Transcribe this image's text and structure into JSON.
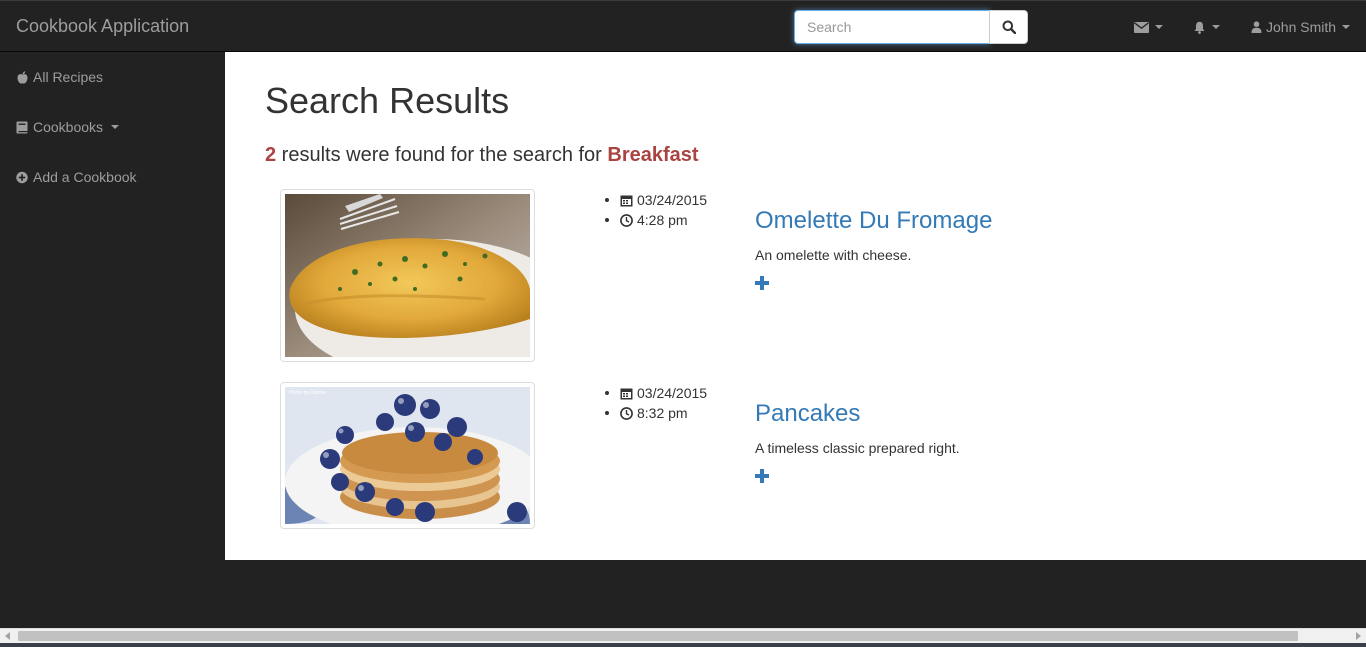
{
  "app": {
    "brand": "Cookbook Application"
  },
  "search": {
    "placeholder": "Search",
    "value": ""
  },
  "nav": {
    "messages_icon": "envelope-icon",
    "alerts_icon": "bell-icon",
    "user_name": "John Smith"
  },
  "sidebar": {
    "items": [
      {
        "label": "All Recipes",
        "icon": "apple-icon"
      },
      {
        "label": "Cookbooks",
        "icon": "book-icon"
      },
      {
        "label": "Add a Cookbook",
        "icon": "plus-circle-icon"
      }
    ]
  },
  "main": {
    "title": "Search Results",
    "summary": {
      "count": "2",
      "text": " results were found for the search for ",
      "query": "Breakfast"
    },
    "results": [
      {
        "date": "03/24/2015",
        "time": "4:28 pm",
        "title": "Omelette Du Fromage",
        "description": "An omelette with cheese."
      },
      {
        "date": "03/24/2015",
        "time": "8:32 pm",
        "title": "Pancakes",
        "description": "A timeless classic prepared right.",
        "photo_credit": "Photo by Dianne"
      }
    ]
  },
  "colors": {
    "navbar_bg": "#222222",
    "link": "#337ab7",
    "highlight": "#a94442",
    "muted_text": "#9d9d9d"
  }
}
